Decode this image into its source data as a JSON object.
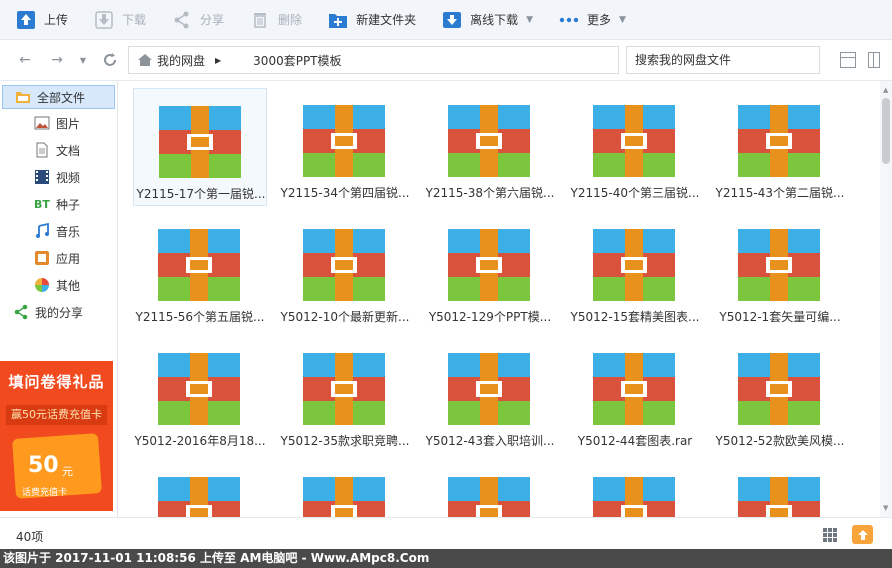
{
  "toolbar": {
    "upload": "上传",
    "download": "下载",
    "share": "分享",
    "delete": "删除",
    "new_folder": "新建文件夹",
    "offline_download": "离线下载",
    "more": "更多"
  },
  "address": {
    "crumbs": [
      "我的网盘",
      "3000套PPT模板"
    ],
    "search_placeholder": "搜索我的网盘文件"
  },
  "sidebar": {
    "items": [
      {
        "label": "全部文件",
        "icon": "folder-icon"
      },
      {
        "label": "图片",
        "icon": "image-icon"
      },
      {
        "label": "文档",
        "icon": "document-icon"
      },
      {
        "label": "视频",
        "icon": "video-icon"
      },
      {
        "label": "种子",
        "icon": "bt-icon"
      },
      {
        "label": "音乐",
        "icon": "music-icon"
      },
      {
        "label": "应用",
        "icon": "app-icon"
      },
      {
        "label": "其他",
        "icon": "other-icon"
      },
      {
        "label": "我的分享",
        "icon": "share-icon"
      }
    ],
    "promo": {
      "title": "填问卷得礼品",
      "subtitle": "赢50元话费充值卡",
      "amount": "50",
      "unit": "元",
      "card_text": "话费充值卡"
    }
  },
  "files": [
    "Y2115-17个第一届锐...",
    "Y2115-34个第四届锐...",
    "Y2115-38个第六届锐...",
    "Y2115-40个第三届锐...",
    "Y2115-43个第二届锐...",
    "Y2115-56个第五届锐...",
    "Y5012-10个最新更新...",
    "Y5012-129个PPT模...",
    "Y5012-15套精美图表...",
    "Y5012-1套矢量可编...",
    "Y5012-2016年8月18...",
    "Y5012-35款求职竞聘...",
    "Y5012-43套入职培训...",
    "Y5012-44套图表.rar",
    "Y5012-52款欧美风模...",
    "",
    "",
    "",
    "",
    ""
  ],
  "footer": {
    "count": "40项"
  },
  "watermark": "该图片于 2017-11-01 11:08:56 上传至 AM电脑吧 - Www.AMpc8.Com",
  "colors": {
    "zip_top": "#3cb0e6",
    "zip_middle": "#d9533c",
    "zip_bottom": "#7cc63d",
    "zip_band": "#e8911d",
    "accent": "#2b7bd3",
    "promo_bg": "#f04a1e"
  }
}
